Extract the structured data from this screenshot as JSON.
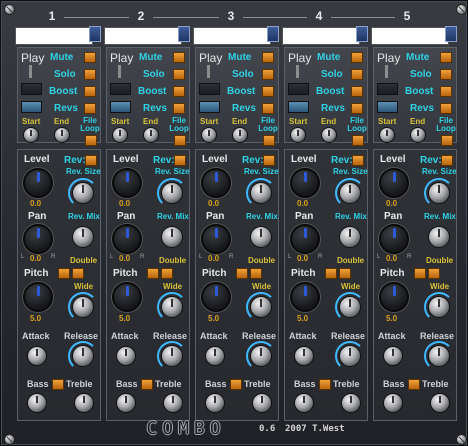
{
  "channels": [
    {
      "number": "1",
      "name": ""
    },
    {
      "number": "2",
      "name": ""
    },
    {
      "number": "3",
      "name": ""
    },
    {
      "number": "4",
      "name": ""
    },
    {
      "number": "5",
      "name": ""
    }
  ],
  "labels": {
    "play": "Play",
    "mute": "Mute",
    "solo": "Solo",
    "boost": "Boost",
    "revs": "Revs",
    "start": "Start",
    "end": "End",
    "file_loop": "File Loop",
    "level": "Level",
    "rev": "Rev:",
    "rev_size": "Rev. Size",
    "pan": "Pan",
    "rev_mix": "Rev. Mix",
    "double": "Double",
    "pitch": "Pitch",
    "wide": "Wide",
    "attack": "Attack",
    "release": "Release",
    "bass": "Bass",
    "treble": "Treble",
    "l": "L",
    "r": "R"
  },
  "values": {
    "level": "0.0",
    "pan": "0.0",
    "pitch": "5.0"
  },
  "footer": {
    "logo": "COMBO",
    "version": "0.6",
    "credit": "2007 T.West"
  },
  "colors": {
    "accent_cyan": "#2fd3e6",
    "accent_yellow": "#d8c23a",
    "switch_orange": "#e88f2b",
    "value_orange": "#d9a21a",
    "ring_blue": "#3fb9ff"
  }
}
